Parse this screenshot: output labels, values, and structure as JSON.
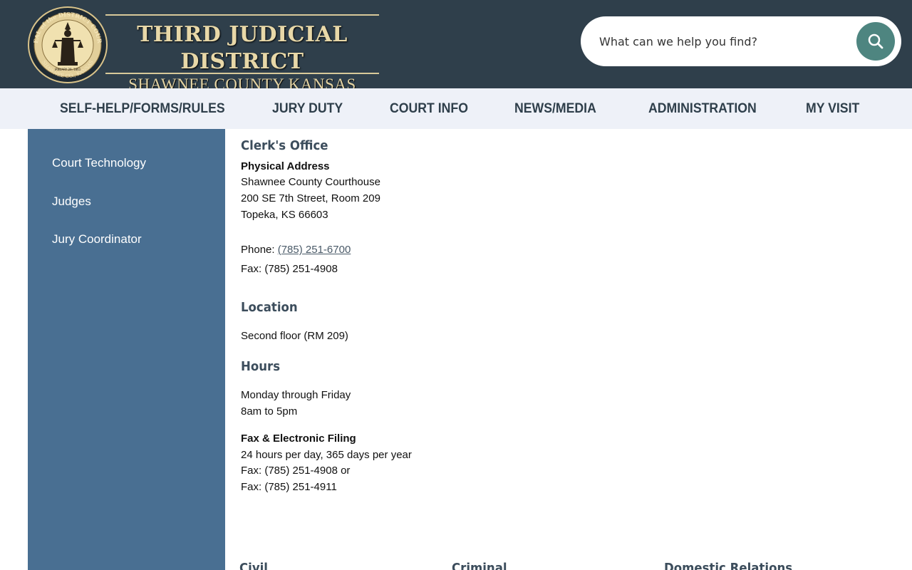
{
  "header": {
    "logo": {
      "title": "THIRD JUDICIAL DISTRICT",
      "subtitle": "SHAWNEE COUNTY KANSAS",
      "seal_text_top": "SEAL of the DISTRICT COURT",
      "seal_text_bottom": "SHAWNEE CO., KANSAS",
      "seal_date": "JANUARY 29, 1861"
    },
    "search": {
      "placeholder": "What can we help you find?",
      "button_icon": "search-icon"
    },
    "colors": {
      "background": "#2f3f4b",
      "gold": "#e8d8a8",
      "search_button": "#4e8580"
    }
  },
  "nav": {
    "items": [
      {
        "label": "SELF-HELP/FORMS/RULES"
      },
      {
        "label": "JURY DUTY"
      },
      {
        "label": "COURT INFO"
      },
      {
        "label": "NEWS/MEDIA"
      },
      {
        "label": "ADMINISTRATION"
      },
      {
        "label": "MY VISIT"
      }
    ]
  },
  "sidebar": {
    "items": [
      {
        "label": "Court Technology"
      },
      {
        "label": "Judges"
      },
      {
        "label": "Jury Coordinator"
      }
    ],
    "color": "#496f92"
  },
  "main": {
    "clerk": {
      "heading": "Clerk's Office",
      "address_label": "Physical Address",
      "address_lines": [
        "Shawnee County Courthouse",
        "200 SE 7th Street, Room 209",
        "Topeka, KS 66603"
      ],
      "phone_label": "Phone: ",
      "phone": "(785) 251-6700",
      "fax": "Fax: (785) 251-4908"
    },
    "location": {
      "heading": "Location",
      "text": "Second floor (RM 209)"
    },
    "hours": {
      "heading": "Hours",
      "days": "Monday through Friday",
      "time": "8am to 5pm",
      "efile_label": "Fax & Electronic Filing",
      "efile_lines": [
        "24 hours per day, 365 days per year",
        "Fax: (785) 251-4908 or",
        "Fax: (785) 251-4911"
      ]
    },
    "columns": [
      "Civil",
      "Criminal",
      "Domestic Relations"
    ]
  }
}
